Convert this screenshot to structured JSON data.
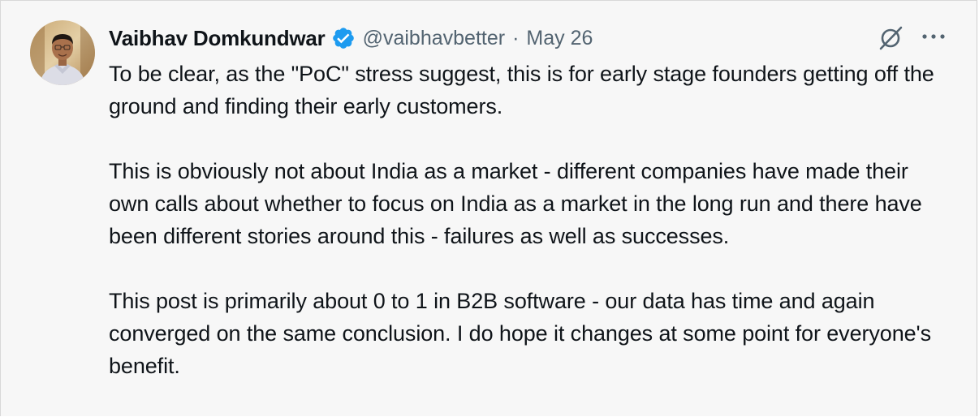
{
  "tweet": {
    "author_name": "Vaibhav Domkundwar",
    "handle": "@vaibhavbetter",
    "separator": "·",
    "date": "May 26",
    "verified": true,
    "icons": {
      "avatar": "profile-photo",
      "verified": "verified-badge-icon",
      "grok": "grok-icon",
      "more": "more-options-icon"
    },
    "colors": {
      "verified_blue": "#1d9bf0",
      "secondary_text": "#536471",
      "primary_text": "#0f1419",
      "card_background": "#f7f7f7"
    },
    "paragraphs": [
      "To be clear, as the \"PoC\" stress suggest, this is for early stage founders getting off the ground and finding their early customers.",
      "This is obviously not about India as a market - different companies have made their own calls about whether to focus on India as a market in the long run and there have been different stories around this - failures as well as successes.",
      "This post is primarily about 0 to 1 in B2B software - our data has time and again converged on the same conclusion. I do hope it changes at some point for everyone's benefit."
    ]
  }
}
